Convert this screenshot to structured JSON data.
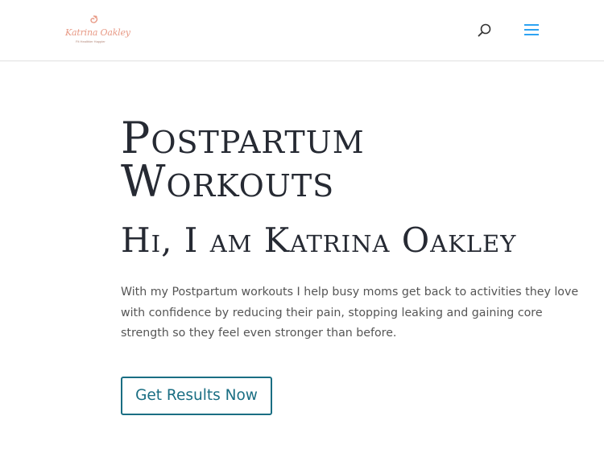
{
  "header": {
    "logo": {
      "name": "Katrina Oakley",
      "tagline": "Fit Healthier Happier"
    },
    "search_icon": "search-icon",
    "menu_icon": "hamburger-menu-icon"
  },
  "hero": {
    "title": "Postpartum Workouts",
    "subtitle": "Hi, I am Katrina Oakley",
    "intro": "With my Postpartum workouts I help busy moms get back to activities they love with confidence by reducing their pain, stopping leaking and gaining core strength so they feel even stronger than before.",
    "cta_label": "Get Results Now"
  },
  "colors": {
    "accent": "#2ea3f2",
    "heading": "#262a33",
    "body_text": "#555555",
    "button": "#1a6e83",
    "logo": "#e89a86"
  }
}
